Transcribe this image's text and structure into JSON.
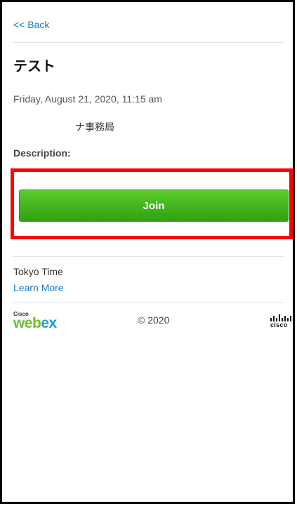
{
  "nav": {
    "back_label": "<< Back"
  },
  "meeting": {
    "title": "テスト",
    "datetime": "Friday, August 21, 2020, 11:15 am",
    "host": "ナ事務局",
    "description_label": "Description:"
  },
  "actions": {
    "join_label": "Join"
  },
  "timezone": {
    "label": "Tokyo Time",
    "learn_more_label": "Learn More"
  },
  "footer": {
    "webex_small": "Cisco",
    "webex_word_part1": "web",
    "webex_word_part2": "ex",
    "copyright": "© 2020",
    "cisco_word": "cisco"
  },
  "colors": {
    "link": "#1a78c2",
    "join_button": "#45b520",
    "highlight": "#ff0000"
  }
}
